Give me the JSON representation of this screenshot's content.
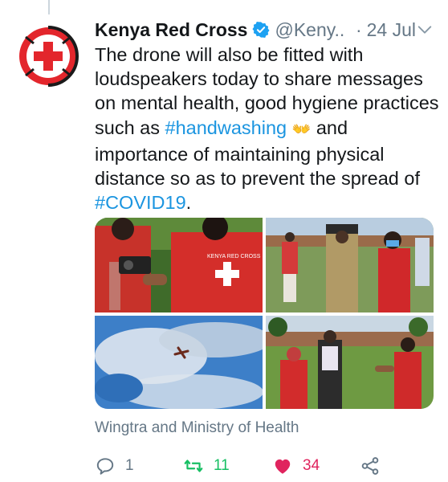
{
  "tweet": {
    "author_name": "Kenya Red Cross",
    "handle": "@Keny...",
    "date_separator": "·",
    "date": "24 Jul",
    "text": {
      "part1": "The drone will also be fitted with loudspeakers today to share messages on mental health, good hygiene practices such as ",
      "hashtag1": "#handwashing",
      "emoji": "👐",
      "part2": " and importance of maintaining physical distance so as to prevent the spread of ",
      "hashtag2": "#COVID19",
      "part3": "."
    },
    "location": "Wingtra and Ministry of Health",
    "actions": {
      "reply_count": "1",
      "retweet_count": "11",
      "like_count": "34"
    },
    "vest_text": "KENYA RED CROSS"
  },
  "colors": {
    "link": "#1b95e0",
    "retweet": "#17bf63",
    "like": "#e0245e",
    "secondary": "#657786",
    "verified": "#1da1f2",
    "brand_red": "#e3262c"
  },
  "icons": {
    "avatar": "red-cross-logo",
    "verified": "verified-badge-icon",
    "caret": "chevron-down-icon",
    "reply": "reply-icon",
    "retweet": "retweet-icon",
    "like": "heart-icon",
    "share": "share-icon"
  }
}
